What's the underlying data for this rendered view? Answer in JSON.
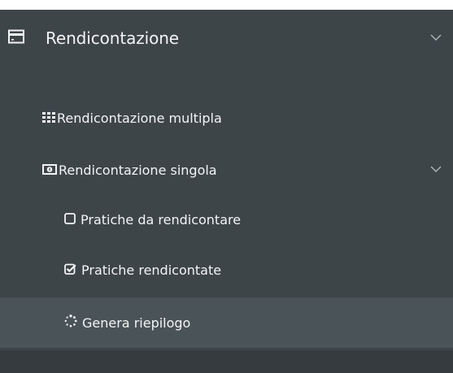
{
  "menu": {
    "header": {
      "label": "Rendicontazione",
      "icon": "credit-card-icon"
    },
    "items": [
      {
        "label": "Rendicontazione multipla",
        "icon": "grid-icon"
      },
      {
        "label": "Rendicontazione singola",
        "icon": "money-bill-icon"
      }
    ],
    "subitems": [
      {
        "label": "Pratiche da rendicontare",
        "icon": "empty-checkbox-icon"
      },
      {
        "label": "Pratiche rendicontate",
        "icon": "checked-checkbox-icon"
      },
      {
        "label": "Genera riepilogo",
        "icon": "spinner-icon",
        "active": true
      }
    ]
  },
  "colors": {
    "sidebar_bg": "#3e4549",
    "active_bg": "#4a5358",
    "bottom_band": "#353b3f",
    "text": "#f2f4f5"
  }
}
